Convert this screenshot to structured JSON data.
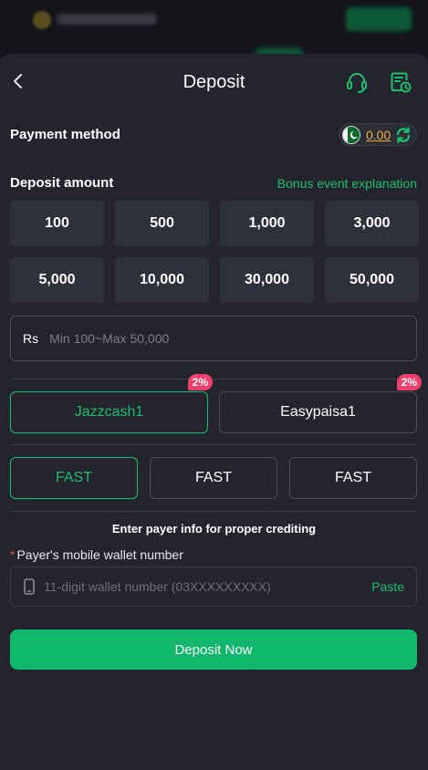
{
  "header": {
    "title": "Deposit",
    "back_icon": "chevron-left-icon",
    "support_icon": "headset-icon",
    "history_icon": "record-clock-icon"
  },
  "payment": {
    "label": "Payment method",
    "balance": "0.00",
    "flag_icon": "pakistan-flag-icon",
    "refresh_icon": "refresh-icon"
  },
  "deposit": {
    "label": "Deposit amount",
    "bonus_link": "Bonus event explanation",
    "amounts": [
      "100",
      "500",
      "1,000",
      "3,000",
      "5,000",
      "10,000",
      "30,000",
      "50,000"
    ],
    "currency": "Rs",
    "placeholder": "Min 100~Max 50,000"
  },
  "channels": [
    {
      "label": "Jazzcash1",
      "badge": "2%",
      "active": true
    },
    {
      "label": "Easypaisa1",
      "badge": "2%",
      "active": false
    }
  ],
  "speeds": [
    {
      "label": "FAST",
      "active": true
    },
    {
      "label": "FAST",
      "active": false
    },
    {
      "label": "FAST",
      "active": false
    }
  ],
  "payer": {
    "title": "Enter payer info for proper crediting",
    "required_mark": "*",
    "label": "Payer's mobile wallet number",
    "placeholder": "11-digit wallet number (03XXXXXXXXX)",
    "paste": "Paste",
    "phone_icon": "phone-icon"
  },
  "submit": {
    "label": "Deposit Now"
  },
  "colors": {
    "accent": "#1fbe6c",
    "button": "#0fb86a",
    "badge": "#ee3f6d",
    "balance": "#f1b23a",
    "background": "#23242e"
  }
}
